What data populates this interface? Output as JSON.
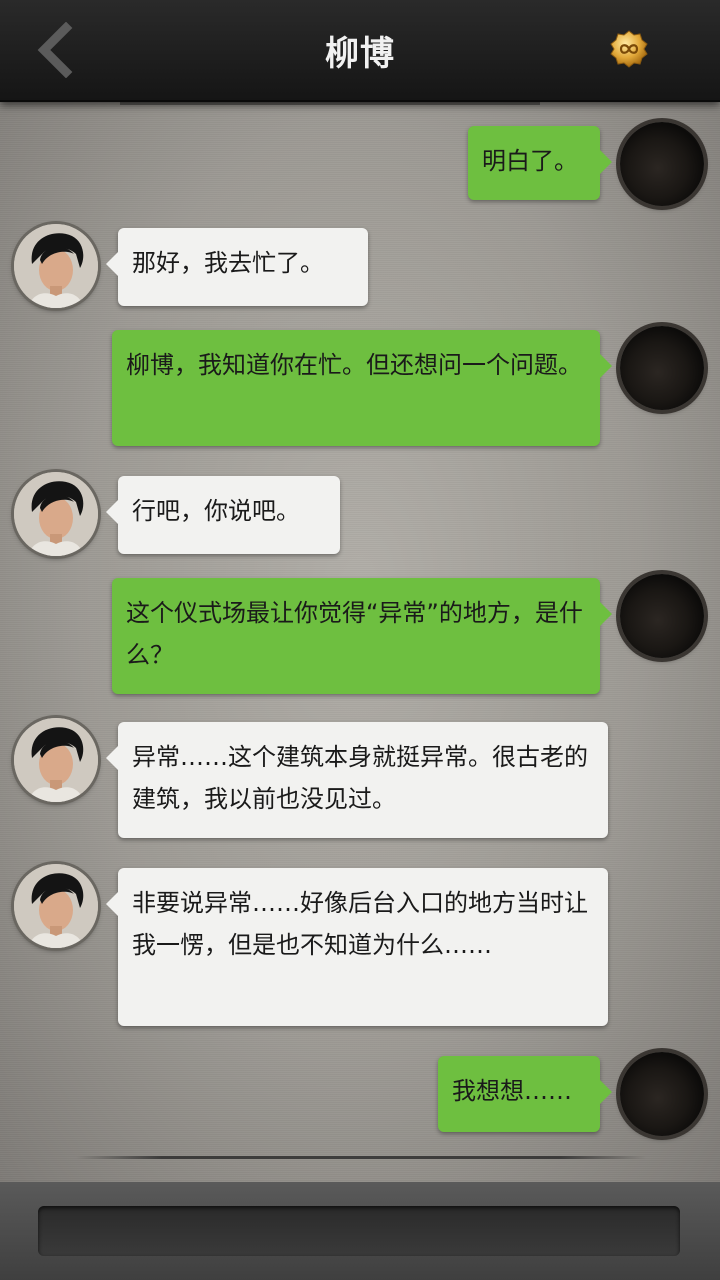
{
  "header": {
    "title": "柳博"
  },
  "messages": [
    {
      "side": "right",
      "text": "明白了。"
    },
    {
      "side": "left",
      "text": "那好，我去忙了。"
    },
    {
      "side": "right",
      "text": "柳博，我知道你在忙。但还想问一个问题。"
    },
    {
      "side": "left",
      "text": "行吧，你说吧。"
    },
    {
      "side": "right",
      "text": "这个仪式场最让你觉得“异常”的地方，是什么？"
    },
    {
      "side": "left",
      "text": "异常……这个建筑本身就挺异常。很古老的建筑，我以前也没见过。"
    },
    {
      "side": "left",
      "text": "非要说异常……好像后台入口的地方当时让我一愣，但是也不知道为什么……"
    },
    {
      "side": "right",
      "text": "我想想……"
    }
  ],
  "colors": {
    "accent_green": "#6ebf40",
    "bubble_white": "#f2f2f0",
    "header_bg": "#1c1c1c"
  },
  "icons": {
    "back": "chevron-left-icon",
    "coin": "infinity-coin-icon"
  }
}
